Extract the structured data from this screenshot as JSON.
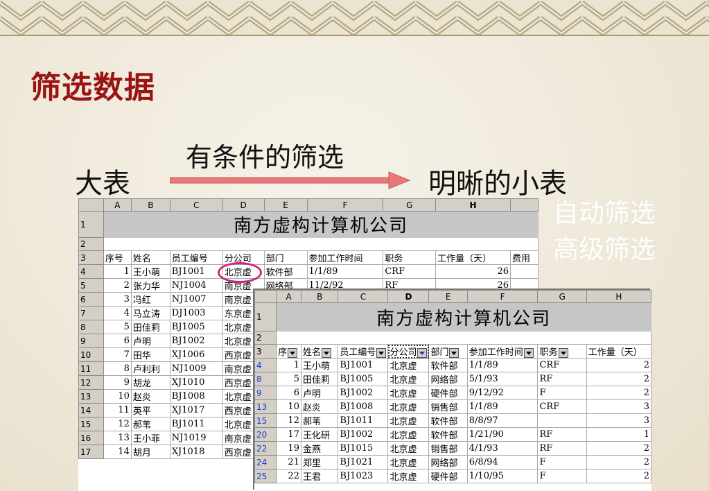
{
  "slide": {
    "title": "筛选数据",
    "left_label": "大表",
    "condition_label": "有条件的筛选",
    "right_label": "明晰的小表",
    "menu": [
      "自动筛选",
      "高级筛选"
    ]
  },
  "colors": {
    "title": "#9a1414",
    "arrow": "#e8787a",
    "circle": "#d0267a",
    "menu_text": "#ffffff"
  },
  "big_sheet": {
    "col_headers": [
      "A",
      "B",
      "C",
      "D",
      "E",
      "F",
      "G",
      "H"
    ],
    "title": "南方虚构计算机公司",
    "header_row": [
      "序号",
      "姓名",
      "员工编号",
      "分公司",
      "部门",
      "参加工作时间",
      "职务",
      "工作量（天）",
      "费用"
    ],
    "rows": [
      {
        "r": "4",
        "cells": [
          "1",
          "王小萌",
          "BJ1001",
          "北京虚",
          "软件部",
          "1/1/89",
          "CRF",
          "26"
        ]
      },
      {
        "r": "5",
        "cells": [
          "2",
          "张力华",
          "NJ1004",
          "南京虚",
          "网络部",
          "11/2/92",
          "RF",
          "26"
        ]
      },
      {
        "r": "6",
        "cells": [
          "3",
          "冯红",
          "NJ1007",
          "南京虚",
          "",
          "",
          "",
          ""
        ]
      },
      {
        "r": "7",
        "cells": [
          "4",
          "马立涛",
          "DJ1003",
          "东京虚",
          "",
          "",
          "",
          ""
        ]
      },
      {
        "r": "8",
        "cells": [
          "5",
          "田佳莉",
          "BJ1005",
          "北京虚",
          "",
          "",
          "",
          ""
        ]
      },
      {
        "r": "9",
        "cells": [
          "6",
          "卢明",
          "BJ1002",
          "北京虚",
          "",
          "",
          "",
          ""
        ]
      },
      {
        "r": "10",
        "cells": [
          "7",
          "田华",
          "XJ1006",
          "西京虚",
          "",
          "",
          "",
          ""
        ]
      },
      {
        "r": "11",
        "cells": [
          "8",
          "卢利利",
          "NJ1009",
          "南京虚",
          "",
          "",
          "",
          ""
        ]
      },
      {
        "r": "12",
        "cells": [
          "9",
          "胡龙",
          "XJ1010",
          "西京虚",
          "",
          "",
          "",
          ""
        ]
      },
      {
        "r": "13",
        "cells": [
          "10",
          "赵炎",
          "BJ1008",
          "北京虚",
          "",
          "",
          "",
          ""
        ]
      },
      {
        "r": "14",
        "cells": [
          "11",
          "英平",
          "XJ1017",
          "西京虚",
          "",
          "",
          "",
          ""
        ]
      },
      {
        "r": "15",
        "cells": [
          "12",
          "郝苇",
          "BJ1011",
          "北京虚",
          "",
          "",
          "",
          ""
        ]
      },
      {
        "r": "16",
        "cells": [
          "13",
          "王小菲",
          "NJ1019",
          "南京虚",
          "",
          "",
          "",
          ""
        ]
      },
      {
        "r": "17",
        "cells": [
          "14",
          "胡月",
          "XJ1018",
          "西京虚",
          "",
          "",
          "",
          ""
        ]
      }
    ]
  },
  "small_sheet": {
    "col_headers": [
      "A",
      "B",
      "C",
      "D",
      "E",
      "F",
      "G",
      "H"
    ],
    "title": "南方虚构计算机公司",
    "header_row": [
      "序",
      "姓名",
      "员工编号",
      "分公司",
      "部门",
      "参加工作时间",
      "职务",
      "工作量（天）"
    ],
    "rows": [
      {
        "r": "4",
        "cells": [
          "1",
          "王小萌",
          "BJ1001",
          "北京虚",
          "软件部",
          "1/1/89",
          "CRF",
          "2"
        ]
      },
      {
        "r": "8",
        "cells": [
          "5",
          "田佳莉",
          "BJ1005",
          "北京虚",
          "网络部",
          "5/1/93",
          "RF",
          "2"
        ]
      },
      {
        "r": "9",
        "cells": [
          "6",
          "卢明",
          "BJ1002",
          "北京虚",
          "硬件部",
          "9/12/92",
          "F",
          "2"
        ]
      },
      {
        "r": "13",
        "cells": [
          "10",
          "赵炎",
          "BJ1008",
          "北京虚",
          "销售部",
          "1/1/89",
          "CRF",
          "3"
        ]
      },
      {
        "r": "15",
        "cells": [
          "12",
          "郝苇",
          "BJ1011",
          "北京虚",
          "软件部",
          "8/8/97",
          "",
          "3"
        ]
      },
      {
        "r": "20",
        "cells": [
          "17",
          "王化研",
          "BJ1002",
          "北京虚",
          "软件部",
          "1/21/90",
          "RF",
          "1"
        ]
      },
      {
        "r": "22",
        "cells": [
          "19",
          "金燕",
          "BJ1015",
          "北京虚",
          "销售部",
          "4/1/93",
          "RF",
          "2"
        ]
      },
      {
        "r": "24",
        "cells": [
          "21",
          "郑里",
          "BJ1021",
          "北京虚",
          "网络部",
          "6/8/94",
          "F",
          "2"
        ]
      },
      {
        "r": "25",
        "cells": [
          "22",
          "王君",
          "BJ1023",
          "北京虚",
          "硬件部",
          "1/10/95",
          "F",
          "2"
        ]
      }
    ]
  }
}
